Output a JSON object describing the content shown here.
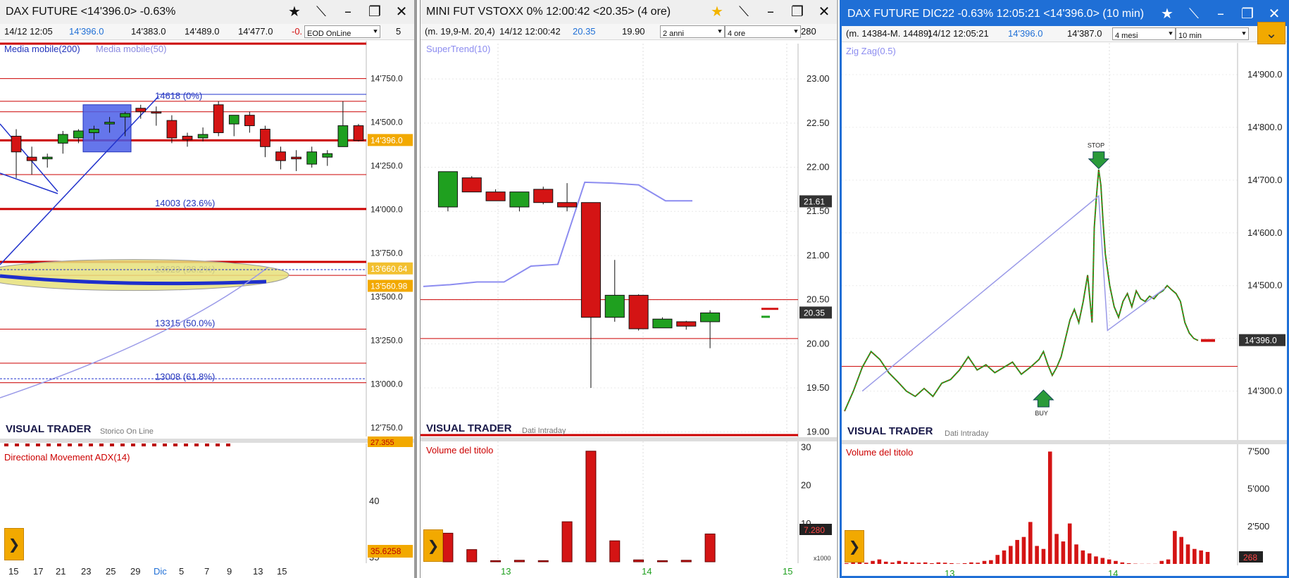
{
  "colors": {
    "up": "#1fa01f",
    "down": "#d41414",
    "axis": "#222",
    "grid": "#e0e0e0",
    "fib": "#cc0000",
    "selected": "#1f6fd6",
    "accent": "#f2a900"
  },
  "panel1": {
    "title": "DAX FUTURE <14'396.0>  -0.63%",
    "info": {
      "date": "14/12 12:05",
      "last": "14'396.0",
      "open": "14'383.0",
      "high": "14'489.0",
      "low": "14'477.0",
      "change": "-0.",
      "mode": "EOD OnLine",
      "suffix": "5"
    },
    "indicators": [
      "Media mobile(200)",
      "Media mobile(50)"
    ],
    "brand": "VISUAL TRADER",
    "brand_sub": "Storico On Line",
    "lower_label": "Directional Movement ADX(14)",
    "lower_value": "35.6258",
    "lower_ticks": [
      "40",
      "35"
    ],
    "lower_top_value": "27.355",
    "badges": [
      {
        "label": "14'396.0",
        "price": 14396,
        "color": "#f2a900"
      },
      {
        "label": "13'660.64",
        "price": 13660.64,
        "color": "#f2c030"
      },
      {
        "label": "13'560.98",
        "price": 13560.98,
        "color": "#f2a900"
      }
    ],
    "fib": [
      {
        "label": "14618 (0%)",
        "price": 14618
      },
      {
        "label": "14003 (23.6%)",
        "price": 14003
      },
      {
        "label": "13623 (38.2%)",
        "price": 13623
      },
      {
        "label": "13315 (50.0%)",
        "price": 13315
      },
      {
        "label": "13008 (61.8%)",
        "price": 13008
      }
    ],
    "x_labels": [
      "15",
      "17",
      "21",
      "23",
      "25",
      "29",
      "Dic",
      "5",
      "7",
      "9",
      "13",
      "15"
    ]
  },
  "panel2": {
    "title": "MINI FUT VSTOXX 0%  12:00:42  <20.35>  (4 ore)",
    "info": {
      "range": "(m. 19,9-M. 20,4)",
      "datetime": "14/12 12:00:42",
      "last": "20.35",
      "prev": "19.90",
      "period": "2 anni",
      "interval": "4 ore",
      "suffix": "280"
    },
    "indicator": "SuperTrend(10)",
    "brand": "VISUAL TRADER",
    "brand_sub": "Dati Intraday",
    "lower_label": "Volume del titolo",
    "lower_ticks": [
      "30",
      "20",
      "10"
    ],
    "lower_value": "7.280",
    "multiplier": "x1000",
    "badges": [
      {
        "label": "21.61",
        "price": 21.61,
        "color": "#333"
      },
      {
        "label": "20.35",
        "price": 20.35,
        "color": "#333"
      }
    ],
    "x_labels": [
      "13",
      "14",
      "15"
    ]
  },
  "panel3": {
    "title": "DAX FUTURE DIC22  -0.63%  12:05:21  <14'396.0>  (10 min)",
    "info": {
      "range": "(m. 14384-M. 14489)",
      "datetime": "14/12 12:05:21",
      "last": "14'396.0",
      "prev": "14'387.0",
      "period": "4 mesi",
      "interval": "10 min"
    },
    "indicator": "Zig Zag(0.5)",
    "brand": "VISUAL TRADER",
    "brand_sub": "Dati Intraday",
    "lower_label": "Volume del titolo",
    "lower_ticks": [
      "7'500",
      "5'000",
      "2'500"
    ],
    "lower_value": "268",
    "badges": [
      {
        "label": "14'396.0",
        "price": 14396,
        "color": "#333"
      }
    ],
    "signals": {
      "stop": "STOP",
      "buy": "BUY"
    },
    "x_labels": [
      "13",
      "14"
    ]
  },
  "chart_data": [
    {
      "type": "candlestick",
      "title": "DAX FUTURE",
      "x_labels": [
        "15",
        "17",
        "21",
        "23",
        "25",
        "29",
        "Dic",
        "5",
        "7",
        "9",
        "13",
        "15"
      ],
      "y_ticks": [
        14750,
        14500,
        14250,
        14000,
        13750,
        13500,
        13250,
        13000,
        12750
      ],
      "ylim": [
        12700,
        14950
      ],
      "candles": [
        {
          "o": 14420,
          "h": 14460,
          "l": 14180,
          "c": 14330
        },
        {
          "o": 14300,
          "h": 14360,
          "l": 14200,
          "c": 14280
        },
        {
          "o": 14290,
          "h": 14320,
          "l": 14240,
          "c": 14300
        },
        {
          "o": 14380,
          "h": 14450,
          "l": 14320,
          "c": 14430
        },
        {
          "o": 14410,
          "h": 14460,
          "l": 14380,
          "c": 14450
        },
        {
          "o": 14440,
          "h": 14480,
          "l": 14400,
          "c": 14460
        },
        {
          "o": 14490,
          "h": 14530,
          "l": 14440,
          "c": 14500
        },
        {
          "o": 14530,
          "h": 14560,
          "l": 14420,
          "c": 14550
        },
        {
          "o": 14580,
          "h": 14600,
          "l": 14520,
          "c": 14560
        },
        {
          "o": 14560,
          "h": 14590,
          "l": 14480,
          "c": 14555
        },
        {
          "o": 14510,
          "h": 14540,
          "l": 14380,
          "c": 14410
        },
        {
          "o": 14420,
          "h": 14440,
          "l": 14360,
          "c": 14400
        },
        {
          "o": 14410,
          "h": 14470,
          "l": 14390,
          "c": 14430
        },
        {
          "o": 14600,
          "h": 14620,
          "l": 14420,
          "c": 14440
        },
        {
          "o": 14490,
          "h": 14540,
          "l": 14420,
          "c": 14540
        },
        {
          "o": 14540,
          "h": 14560,
          "l": 14440,
          "c": 14480
        },
        {
          "o": 14460,
          "h": 14480,
          "l": 14300,
          "c": 14360
        },
        {
          "o": 14330,
          "h": 14360,
          "l": 14230,
          "c": 14280
        },
        {
          "o": 14300,
          "h": 14340,
          "l": 14220,
          "c": 14290
        },
        {
          "o": 14260,
          "h": 14360,
          "l": 14240,
          "c": 14330
        },
        {
          "o": 14300,
          "h": 14340,
          "l": 14250,
          "c": 14320
        },
        {
          "o": 14360,
          "h": 14620,
          "l": 14360,
          "c": 14480
        },
        {
          "o": 14480,
          "h": 14490,
          "l": 14390,
          "c": 14396
        }
      ],
      "horizontal_levels": [
        14396,
        14003,
        13623,
        13315,
        13008,
        14750,
        14620,
        14560,
        14200,
        13700,
        13120
      ]
    },
    {
      "type": "candlestick",
      "title": "MINI FUT VSTOXX",
      "x_labels": [
        "13",
        "14",
        "15"
      ],
      "y_ticks": [
        23.0,
        22.5,
        22.0,
        21.5,
        21.0,
        20.5,
        20.0,
        19.5,
        19.0
      ],
      "ylim": [
        18.95,
        23.4
      ],
      "candles": [
        {
          "o": 21.55,
          "h": 21.95,
          "l": 21.5,
          "c": 21.95
        },
        {
          "o": 21.88,
          "h": 21.9,
          "l": 21.72,
          "c": 21.72
        },
        {
          "o": 21.72,
          "h": 21.75,
          "l": 21.64,
          "c": 21.62
        },
        {
          "o": 21.55,
          "h": 21.72,
          "l": 21.5,
          "c": 21.72
        },
        {
          "o": 21.75,
          "h": 21.78,
          "l": 21.58,
          "c": 21.6
        },
        {
          "o": 21.6,
          "h": 21.82,
          "l": 21.5,
          "c": 21.55
        },
        {
          "o": 21.6,
          "h": 21.6,
          "l": 19.5,
          "c": 20.3
        },
        {
          "o": 20.3,
          "h": 20.95,
          "l": 20.25,
          "c": 20.55
        },
        {
          "o": 20.55,
          "h": 20.56,
          "l": 20.15,
          "c": 20.17
        },
        {
          "o": 20.18,
          "h": 20.3,
          "l": 20.18,
          "c": 20.28
        },
        {
          "o": 20.25,
          "h": 20.26,
          "l": 20.16,
          "c": 20.2
        },
        {
          "o": 20.25,
          "h": 20.38,
          "l": 19.95,
          "c": 20.35
        }
      ],
      "supertrend": [
        20.65,
        20.67,
        20.7,
        20.7,
        20.88,
        20.9,
        21.83,
        21.82,
        21.8,
        21.62,
        21.62
      ],
      "volume": [
        7.5,
        3.2,
        0.3,
        0.4,
        0.3,
        10.5,
        29,
        5.5,
        0.5,
        0.3,
        0.4,
        7.3
      ],
      "volume_ylim": [
        0,
        31
      ]
    },
    {
      "type": "line",
      "title": "DAX FUTURE DIC22",
      "x_labels": [
        "13",
        "14"
      ],
      "y_ticks": [
        14900,
        14800,
        14700,
        14600,
        14500,
        14400,
        14300
      ],
      "ylim": [
        14210,
        14960
      ],
      "price_path": [
        [
          0,
          14262
        ],
        [
          2,
          14300
        ],
        [
          4,
          14345
        ],
        [
          6,
          14375
        ],
        [
          8,
          14360
        ],
        [
          10,
          14335
        ],
        [
          12,
          14318
        ],
        [
          14,
          14300
        ],
        [
          16,
          14290
        ],
        [
          18,
          14305
        ],
        [
          20,
          14290
        ],
        [
          22,
          14315
        ],
        [
          24,
          14322
        ],
        [
          26,
          14340
        ],
        [
          28,
          14365
        ],
        [
          30,
          14340
        ],
        [
          32,
          14350
        ],
        [
          34,
          14335
        ],
        [
          36,
          14345
        ],
        [
          38,
          14355
        ],
        [
          40,
          14332
        ],
        [
          42,
          14345
        ],
        [
          44,
          14360
        ],
        [
          45,
          14375
        ],
        [
          46,
          14350
        ],
        [
          47,
          14330
        ],
        [
          48,
          14345
        ],
        [
          49,
          14365
        ],
        [
          50,
          14400
        ],
        [
          51,
          14435
        ],
        [
          52,
          14455
        ],
        [
          53,
          14430
        ],
        [
          54,
          14470
        ],
        [
          55,
          14520
        ],
        [
          56,
          14430
        ],
        [
          56.5,
          14610
        ],
        [
          57,
          14670
        ],
        [
          57.5,
          14720
        ],
        [
          58,
          14690
        ],
        [
          58.5,
          14620
        ],
        [
          59,
          14560
        ],
        [
          60,
          14500
        ],
        [
          61,
          14460
        ],
        [
          62,
          14440
        ],
        [
          63,
          14470
        ],
        [
          64,
          14485
        ],
        [
          65,
          14460
        ],
        [
          66,
          14490
        ],
        [
          67,
          14475
        ],
        [
          68,
          14470
        ],
        [
          69,
          14480
        ],
        [
          70,
          14475
        ],
        [
          71,
          14485
        ],
        [
          72,
          14490
        ],
        [
          73,
          14500
        ],
        [
          74,
          14492
        ],
        [
          75,
          14485
        ],
        [
          76,
          14470
        ],
        [
          77,
          14430
        ],
        [
          78,
          14410
        ],
        [
          79,
          14400
        ],
        [
          80,
          14396
        ]
      ],
      "zigzag": [
        [
          4,
          14300
        ],
        [
          57.5,
          14670
        ],
        [
          59.5,
          14415
        ],
        [
          72.5,
          14495
        ]
      ],
      "volume": [
        0.05,
        0.1,
        0.12,
        0.08,
        0.2,
        0.3,
        0.15,
        0.1,
        0.2,
        0.12,
        0.1,
        0.08,
        0.1,
        0.05,
        0.1,
        0.08,
        0.05,
        0.02,
        0.05,
        0.1,
        0.08,
        0.2,
        0.25,
        0.6,
        0.9,
        1.2,
        1.6,
        1.8,
        2.8,
        1.2,
        1.0,
        7.5,
        2.0,
        1.5,
        2.7,
        1.3,
        0.9,
        0.7,
        0.5,
        0.4,
        0.3,
        0.2,
        0.1,
        0.05,
        0.02,
        0.01,
        0.01,
        0.01,
        0.2,
        0.3,
        2.2,
        1.8,
        1.3,
        1.0,
        0.9,
        0.8
      ],
      "volume_ylim": [
        0,
        7800
      ],
      "signals": [
        {
          "type": "STOP",
          "x": 57.5
        },
        {
          "type": "BUY",
          "x": 45
        }
      ]
    }
  ]
}
